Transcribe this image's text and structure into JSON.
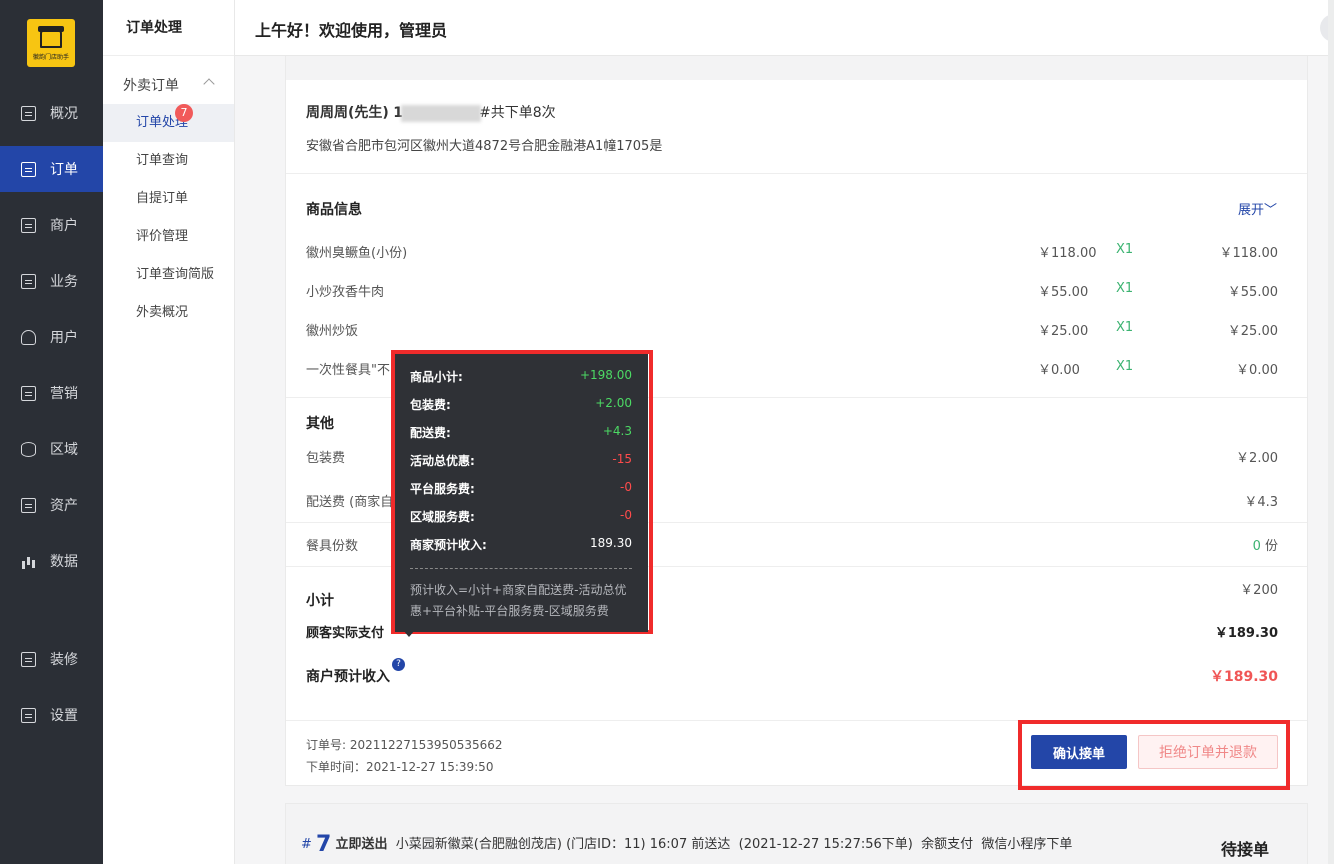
{
  "app": {
    "logo_text": "徽韵门店助手",
    "greeting": "上午好！欢迎使用，管理员"
  },
  "nav": {
    "items": [
      {
        "label": "概况",
        "icon": "chart-board-icon"
      },
      {
        "label": "订单",
        "icon": "order-list-icon",
        "active": true
      },
      {
        "label": "商户",
        "icon": "store-icon"
      },
      {
        "label": "业务",
        "icon": "business-icon"
      },
      {
        "label": "用户",
        "icon": "user-icon"
      },
      {
        "label": "营销",
        "icon": "marketing-icon"
      },
      {
        "label": "区域",
        "icon": "database-icon"
      },
      {
        "label": "资产",
        "icon": "asset-icon"
      },
      {
        "label": "数据",
        "icon": "bar-chart-icon"
      },
      {
        "label": "装修",
        "icon": "decorate-icon"
      },
      {
        "label": "设置",
        "icon": "settings-icon"
      }
    ]
  },
  "subnav": {
    "title": "订单处理",
    "group": "外卖订单",
    "badge": "7",
    "items": [
      "订单处理",
      "订单查询",
      "自提订单",
      "评价管理",
      "订单查询简版",
      "外卖概况"
    ]
  },
  "order": {
    "customer_name": "周周周(先生)",
    "phone_prefix": "1",
    "order_count": "#共下单8次",
    "address": "安徽省合肥市包河区徽州大道4872号合肥金融港A1幢1705是",
    "goods_title": "商品信息",
    "expand": "展开",
    "goods": [
      {
        "name": "徽州臭鳜鱼(小份)",
        "price": "￥118.00",
        "qty": "X1",
        "total": "￥118.00"
      },
      {
        "name": "小炒孜香牛肉",
        "price": "￥55.00",
        "qty": "X1",
        "total": "￥55.00"
      },
      {
        "name": "徽州炒饭",
        "price": "￥25.00",
        "qty": "X1",
        "total": "￥25.00"
      },
      {
        "name": "一次性餐具\"不",
        "price": "￥0.00",
        "qty": "X1",
        "total": "￥0.00"
      }
    ],
    "other_title": "其他",
    "packing_label": "包装费",
    "packing_value": "￥2.00",
    "delivery_label": "配送费  (商家自",
    "delivery_value": "￥4.3",
    "utensil_label": "餐具份数",
    "utensil_count": "0",
    "utensil_unit": " 份",
    "subtotal_label": "小计",
    "subtotal_value": "￥200",
    "paid_label": "顾客实际支付",
    "paid_value": "￥189.30",
    "income_label": "商户预计收入",
    "income_value": "￥189.30",
    "order_no": "订单号: 20211227153950535662",
    "order_time": "下单时间：2021-12-27 15:39:50",
    "confirm_btn": "确认接单",
    "reject_btn": "拒绝订单并退款"
  },
  "tooltip": {
    "rows": [
      {
        "label": "商品小计:",
        "value": "+198.00",
        "color": "green"
      },
      {
        "label": "包装费:",
        "value": "+2.00",
        "color": "green"
      },
      {
        "label": "配送费:",
        "value": "+4.3",
        "color": "green"
      },
      {
        "label": "活动总优惠:",
        "value": "-15",
        "color": "red"
      },
      {
        "label": "平台服务费:",
        "value": "-0",
        "color": "red"
      },
      {
        "label": "区域服务费:",
        "value": "-0",
        "color": "red"
      },
      {
        "label": "商家预计收入:",
        "value": "189.30",
        "color": "white"
      }
    ],
    "formula": "预计收入=小计+商家自配送费-活动总优惠+平台补贴-平台服务费-区域服务费"
  },
  "next_order": {
    "hash": "#",
    "number": "7",
    "type": "立即送出",
    "store": "小菜园新徽菜(合肥融创茂店)",
    "store_id": "(门店ID：11)",
    "deliver_time": "16:07 前送达",
    "placed": "(2021-12-27 15:27:56下单)",
    "payment": "余额支付",
    "channel": "微信小程序下单",
    "status": "待接单"
  },
  "colors": {
    "accent": "#2346a8",
    "nav_bg": "#2b2f36",
    "highlight": "#f02b2b",
    "income": "#f05656"
  }
}
